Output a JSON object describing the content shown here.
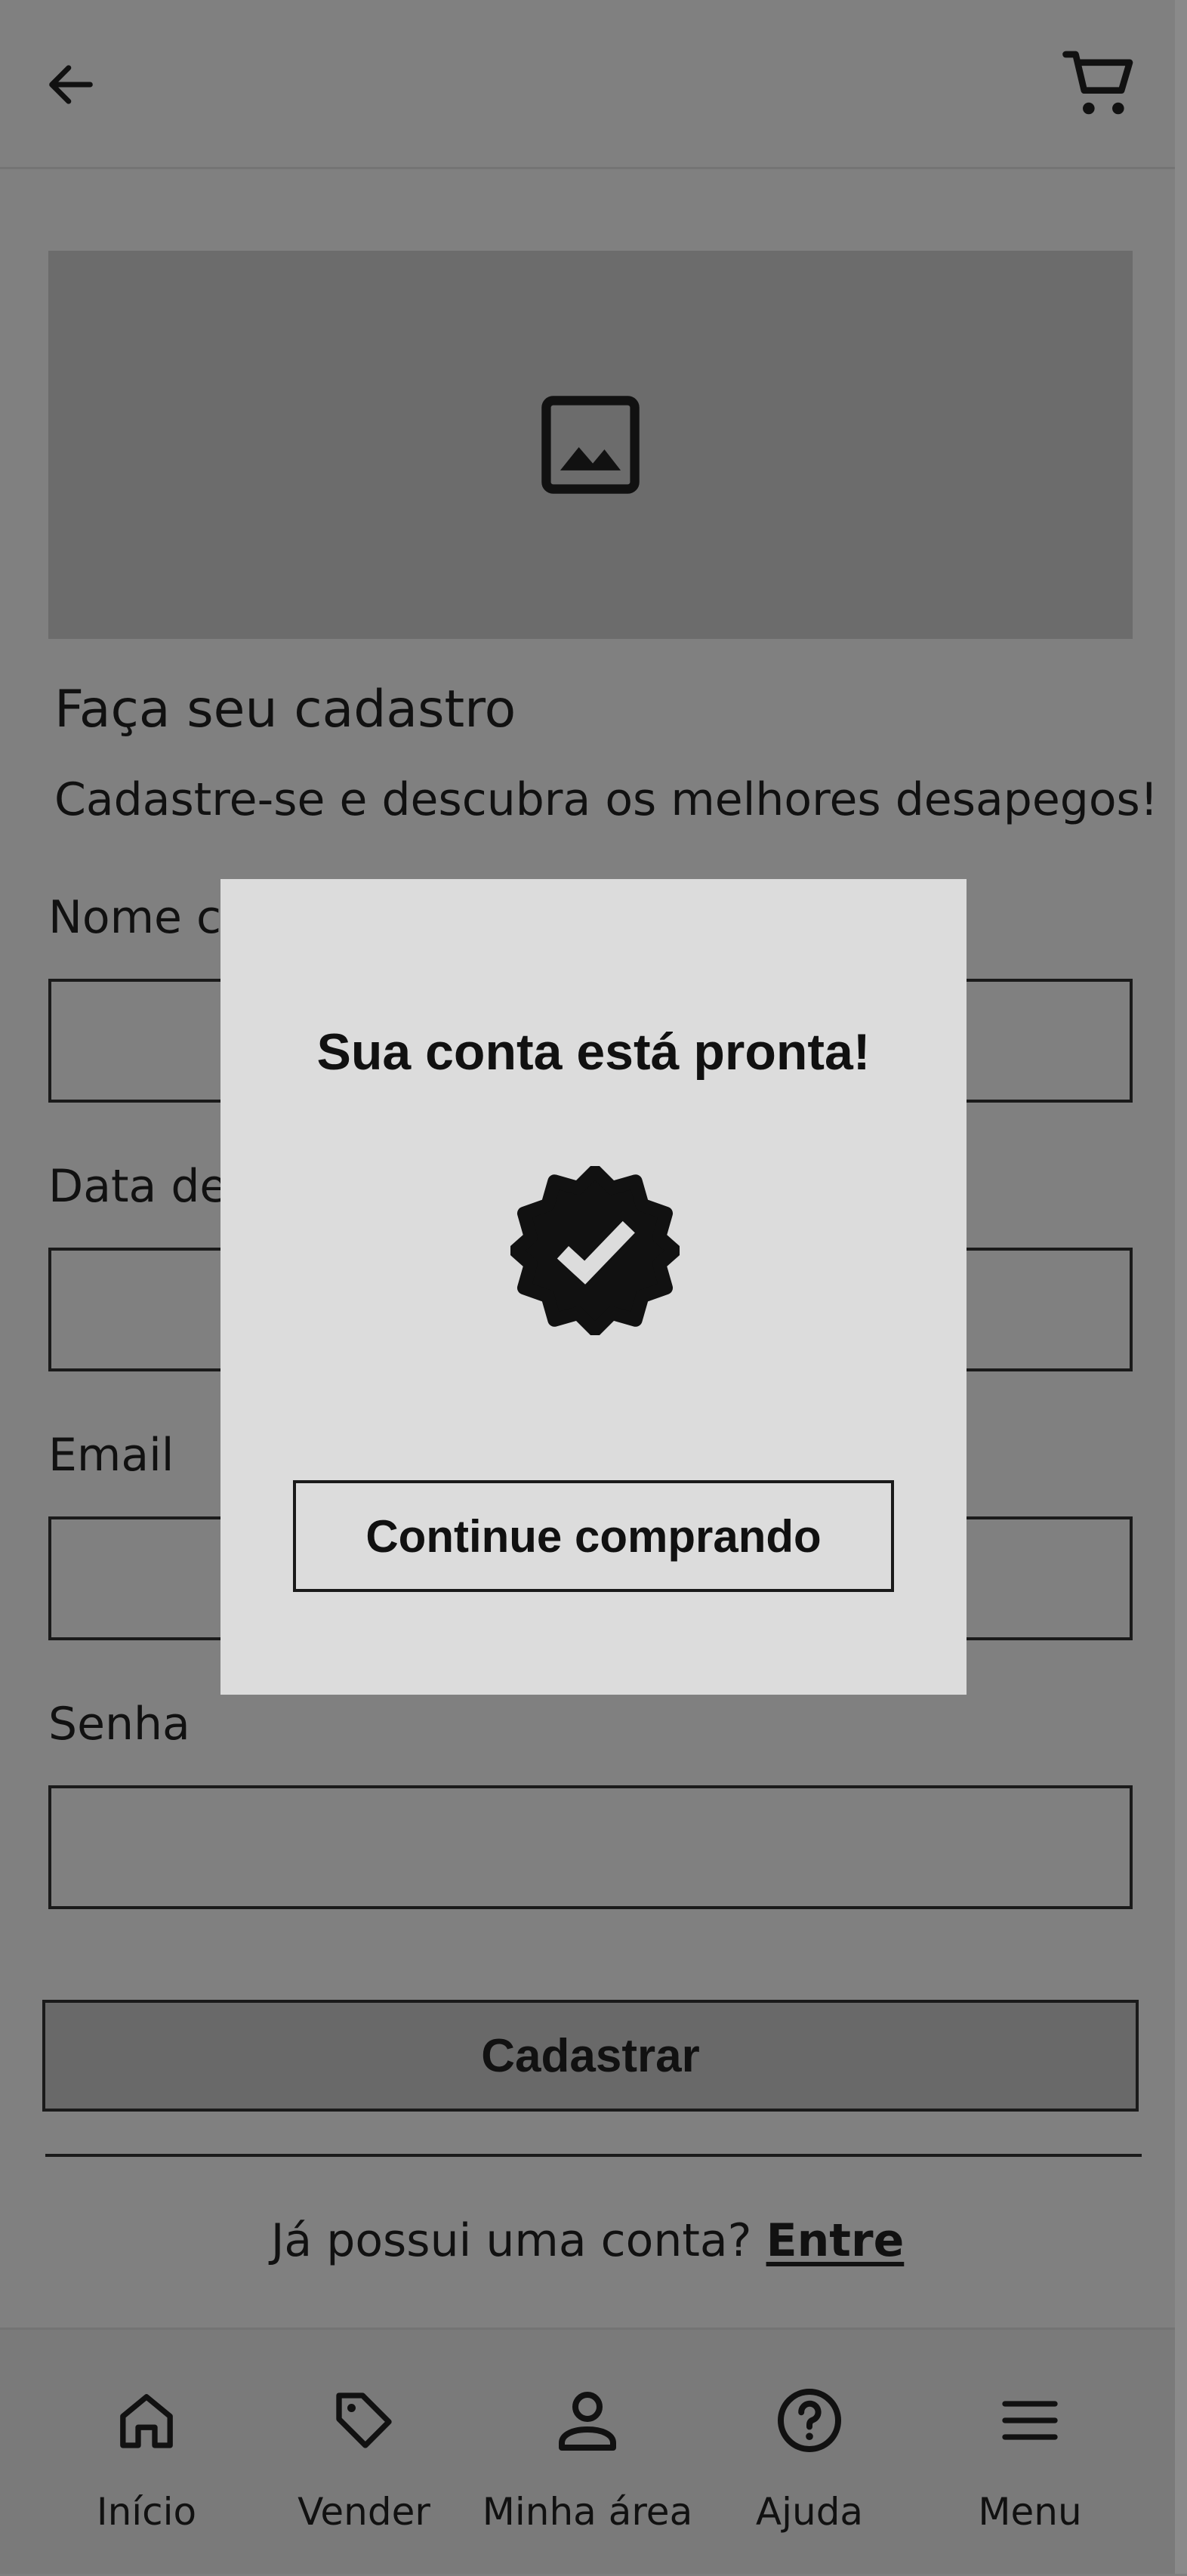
{
  "header": {
    "back_icon": "arrow-left-icon",
    "cart_icon": "shopping-cart-icon"
  },
  "hero": {
    "icon": "image-placeholder-icon"
  },
  "page": {
    "title": "Faça seu cadastro",
    "subtitle": "Cadastre-se e descubra os melhores desapegos!"
  },
  "form": {
    "name_label": "Nome completo",
    "birth_label": "Data de nascimento",
    "email_label": "Email",
    "password_label": "Senha",
    "name_value": "",
    "birth_value": "",
    "email_value": "",
    "password_value": "",
    "submit_label": "Cadastrar"
  },
  "login": {
    "prompt": "Já possui uma conta?",
    "link": "Entre"
  },
  "modal": {
    "title": "Sua conta está pronta!",
    "badge_icon": "verified-badge-icon",
    "button_label": "Continue comprando"
  },
  "bottom_nav": {
    "items": [
      {
        "label": "Início",
        "icon": "home-icon"
      },
      {
        "label": "Vender",
        "icon": "tag-icon"
      },
      {
        "label": "Minha área",
        "icon": "user-icon"
      },
      {
        "label": "Ajuda",
        "icon": "help-circle-icon"
      },
      {
        "label": "Menu",
        "icon": "hamburger-menu-icon"
      }
    ]
  },
  "colors": {
    "overlay_bg": "#808080",
    "modal_bg": "#dcdcdc",
    "text": "#111111"
  }
}
